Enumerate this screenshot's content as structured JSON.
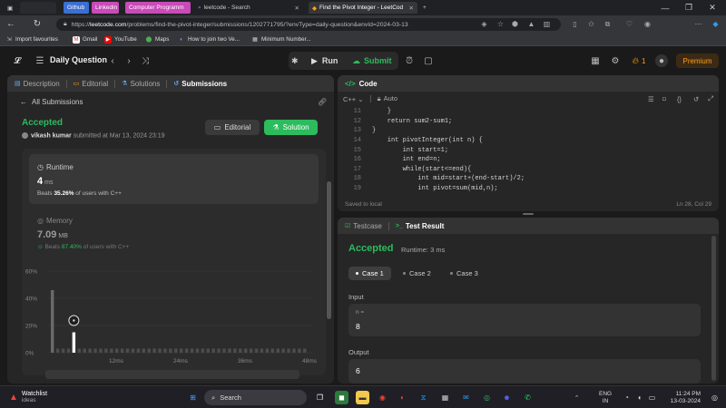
{
  "browser": {
    "tabs": [
      {
        "label": "Github",
        "color": "#3b6fd4"
      },
      {
        "label": "Linkedin",
        "color": "#c94ab8"
      },
      {
        "label": "Computer Programm",
        "color": "#c94ab8"
      },
      {
        "label": "leetcode - Search"
      },
      {
        "label": "Find the Pivot Integer - LeetCod"
      }
    ],
    "url_host": "leetcode.com",
    "url_path": "/problems/find-the-pivot-integer/submissions/1202771795/?envType=daily-question&envId=2024-03-13",
    "bookmarks": [
      "Import favourites",
      "Gmail",
      "YouTube",
      "Maps",
      "How to join two Ve...",
      "Minimum Number..."
    ]
  },
  "header": {
    "title": "Daily Question",
    "run_label": "Run",
    "submit_label": "Submit",
    "streak": "1",
    "premium_label": "Premium"
  },
  "left_panel": {
    "tabs": [
      "Description",
      "Editorial",
      "Solutions",
      "Submissions"
    ],
    "back_label": "All Submissions",
    "status": "Accepted",
    "user": "vikash kumar",
    "submitted_text": "submitted at Mar 13, 2024 23:19",
    "editorial_btn": "Editorial",
    "solution_btn": "Solution",
    "runtime": {
      "label": "Runtime",
      "value": "4",
      "unit": "ms",
      "beats_pre": "Beats",
      "beats_pct": "35.26%",
      "beats_post": "of users with C++"
    },
    "memory": {
      "label": "Memory",
      "value": "7.09",
      "unit": "MB",
      "beats_pre": "Beats",
      "beats_pct": "87.40%",
      "beats_post": "of users with C++"
    }
  },
  "chart_data": {
    "type": "bar",
    "ylim": [
      0,
      60
    ],
    "y_ticks": [
      "60%",
      "40%",
      "20%",
      "0%"
    ],
    "x_ticks": [
      "12ms",
      "24ms",
      "36ms",
      "48ms"
    ],
    "x": [
      0,
      1,
      2,
      3,
      4,
      5,
      6,
      7,
      8,
      9,
      10,
      11,
      12,
      13,
      14,
      15,
      16,
      17,
      18,
      19,
      20,
      21,
      22,
      23,
      24,
      25,
      26,
      27,
      28,
      29,
      30,
      31,
      32,
      33,
      34,
      35,
      36,
      37,
      38,
      39,
      40,
      41,
      42,
      43,
      44,
      45,
      46,
      47
    ],
    "values": [
      46,
      3,
      3,
      3,
      15,
      3,
      3,
      3,
      3,
      3,
      3,
      3,
      3,
      3,
      3,
      3,
      3,
      3,
      3,
      3,
      3,
      3,
      3,
      3,
      3,
      3,
      3,
      3,
      3,
      3,
      3,
      3,
      3,
      3,
      3,
      3,
      3,
      3,
      3,
      3,
      3,
      3,
      3,
      3,
      3,
      3,
      3,
      3
    ],
    "highlight_index": 4
  },
  "code_panel": {
    "title": "Code",
    "language": "C++",
    "mode": "Auto",
    "lines": [
      {
        "n": "11",
        "t": "    }"
      },
      {
        "n": "12",
        "t": "    return sum2-sum1;"
      },
      {
        "n": "13",
        "t": "}"
      },
      {
        "n": "14",
        "t": "    int pivotInteger(int n) {"
      },
      {
        "n": "15",
        "t": "        int start=1;"
      },
      {
        "n": "16",
        "t": "        int end=n;"
      },
      {
        "n": "17",
        "t": "        while(start<=end){"
      },
      {
        "n": "18",
        "t": "            int mid=start+(end-start)/2;"
      },
      {
        "n": "19",
        "t": "            int pivot=sum(mid,n);"
      }
    ],
    "saved": "Saved to local",
    "cursor": "Ln 28, Col 29"
  },
  "result_panel": {
    "tab_testcase": "Testcase",
    "tab_result": "Test Result",
    "status": "Accepted",
    "runtime": "Runtime: 3 ms",
    "cases": [
      "Case 1",
      "Case 2",
      "Case 3"
    ],
    "input_label": "Input",
    "input_key": "n =",
    "input_value": "8",
    "output_label": "Output",
    "output_value": "6"
  },
  "taskbar": {
    "weather_title": "Watchlist",
    "weather_sub": "ideas",
    "search_placeholder": "Search",
    "lang": "ENG",
    "region": "IN",
    "time": "11:24 PM",
    "date": "13-03-2024"
  }
}
